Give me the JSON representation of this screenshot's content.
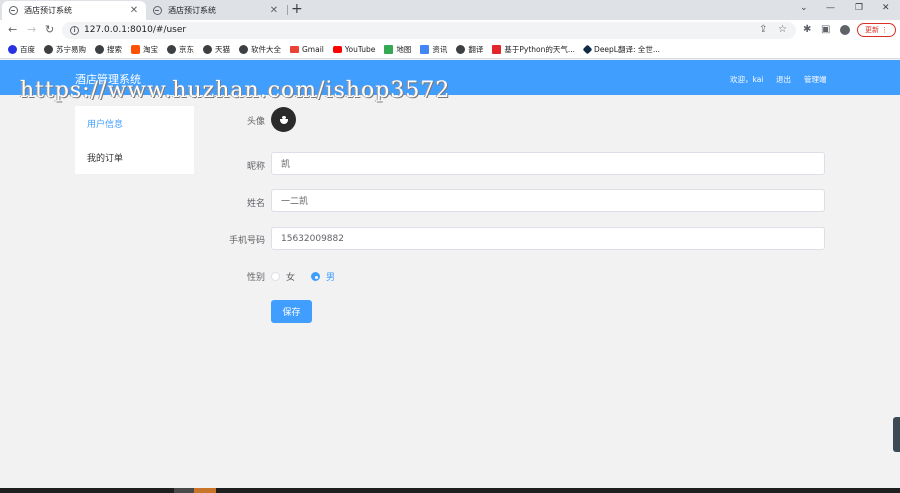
{
  "browser": {
    "tabs": [
      {
        "title": "酒店预订系统",
        "active": true
      },
      {
        "title": "酒店预订系统",
        "active": false
      }
    ],
    "url": "127.0.0.1:8010/#/user",
    "update_label": "更新",
    "bookmarks": [
      {
        "label": "百度",
        "icon": "paw-icon",
        "color": "#2932e1"
      },
      {
        "label": "苏宁易购",
        "icon": "globe-icon",
        "color": "#3c4043"
      },
      {
        "label": "搜索",
        "icon": "globe-icon",
        "color": "#3c4043"
      },
      {
        "label": "淘宝",
        "icon": "taobao-icon",
        "color": "#ff5000"
      },
      {
        "label": "京东",
        "icon": "globe-icon",
        "color": "#3c4043"
      },
      {
        "label": "天猫",
        "icon": "globe-icon",
        "color": "#3c4043"
      },
      {
        "label": "软件大全",
        "icon": "globe-icon",
        "color": "#3c4043"
      },
      {
        "label": "Gmail",
        "icon": "gmail-icon",
        "color": "#ea4335"
      },
      {
        "label": "YouTube",
        "icon": "youtube-icon",
        "color": "#ff0000"
      },
      {
        "label": "地图",
        "icon": "maps-icon",
        "color": "#34a853"
      },
      {
        "label": "资讯",
        "icon": "news-icon",
        "color": "#4285f4"
      },
      {
        "label": "翻译",
        "icon": "globe-icon",
        "color": "#3c4043"
      },
      {
        "label": "基于Python的天气...",
        "icon": "h-icon",
        "color": "#e3262c"
      },
      {
        "label": "DeepL翻译: 全世...",
        "icon": "deepl-icon",
        "color": "#0f2b46"
      }
    ]
  },
  "header": {
    "title": "酒店管理系统",
    "watermark": "https://www.huzhan.com/ishop3572",
    "welcome": "欢迎，kai",
    "logout": "退出",
    "admin": "管理端"
  },
  "sidebar": {
    "items": [
      {
        "label": "用户信息",
        "active": true
      },
      {
        "label": "我的订单",
        "active": false
      }
    ]
  },
  "form": {
    "avatar_label": "头像",
    "nickname_label": "昵称",
    "nickname_value": "凯",
    "name_label": "姓名",
    "name_value": "一二凯",
    "phone_label": "手机号码",
    "phone_value": "15632009882",
    "gender_label": "性别",
    "gender_options": [
      "女",
      "男"
    ],
    "gender_selected": "男",
    "save_label": "保存"
  },
  "colors": {
    "primary": "#409eff",
    "page_bg": "#f2f2f2"
  }
}
